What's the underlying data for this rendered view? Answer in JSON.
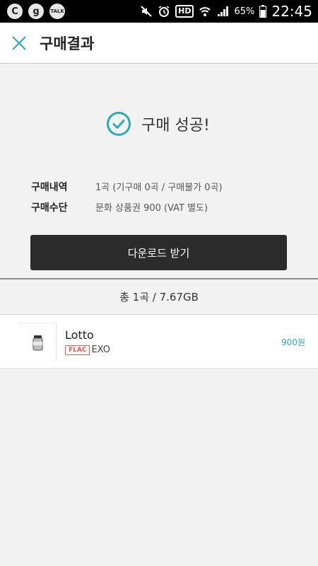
{
  "status_bar": {
    "app_icons": [
      "C",
      "g",
      "TALK"
    ],
    "hd": "HD",
    "battery": "65%",
    "time": "22:45"
  },
  "appbar": {
    "title": "구매결과"
  },
  "result": {
    "message": "구매 성공!",
    "info": [
      {
        "label": "구매내역",
        "value": "1곡 (기구매 0곡 / 구매불가 0곡)"
      },
      {
        "label": "구매수단",
        "value": "문화 상품권 900 (VAT 별도)"
      }
    ],
    "download_label": "다운로드 받기"
  },
  "summary": "총 1곡 / 7.67GB",
  "tracks": [
    {
      "title": "Lotto",
      "format": "FLAC",
      "artist": "EXO",
      "price": "900원"
    }
  ],
  "colors": {
    "accent": "#2ba9c2",
    "flac": "#e05a4e",
    "button": "#2b2b2b"
  }
}
